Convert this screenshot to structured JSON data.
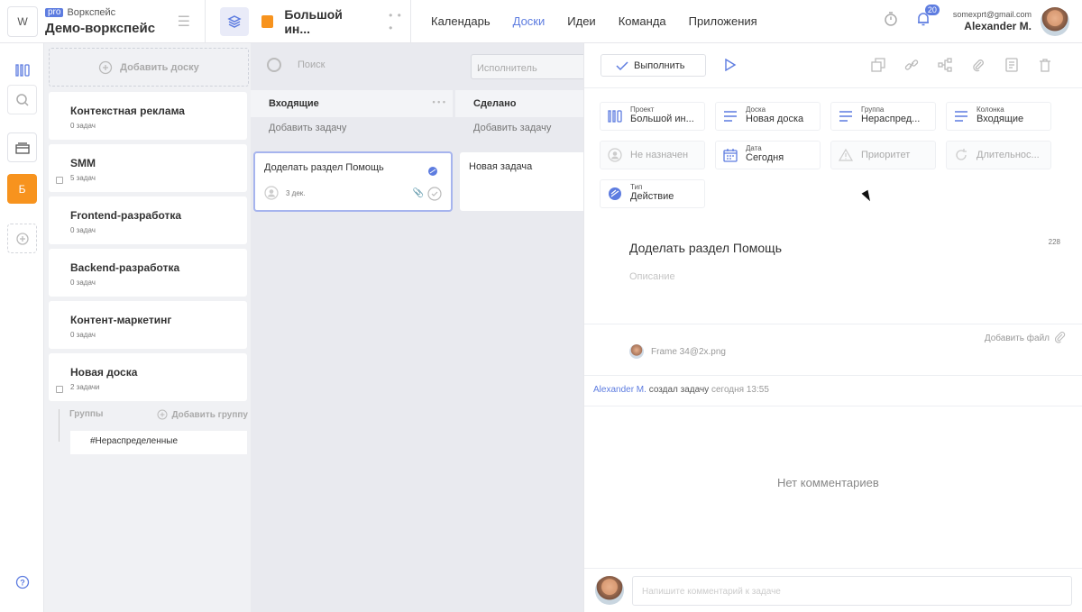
{
  "workspace": {
    "logo_letter": "W",
    "badge": "pro",
    "label": "Воркспейс",
    "name": "Демо-воркспейс"
  },
  "project": {
    "name": "Большой ин...",
    "color": "#f7931e"
  },
  "nav": [
    "Календарь",
    "Доски",
    "Идеи",
    "Команда",
    "Приложения"
  ],
  "nav_active": "Доски",
  "user": {
    "email": "somexprt@gmail.com",
    "name": "Alexander M.",
    "notifications": "20"
  },
  "rail": {
    "letter": "Б"
  },
  "boards": {
    "add_label": "Добавить доску",
    "items": [
      {
        "name": "Контекстная реклама",
        "count": "0 задач"
      },
      {
        "name": "SMM",
        "count": "5 задач"
      },
      {
        "name": "Frontend-разработка",
        "count": "0 задач"
      },
      {
        "name": "Backend-разработка",
        "count": "0 задач"
      },
      {
        "name": "Контент-маркетинг",
        "count": "0 задач"
      },
      {
        "name": "Новая доска",
        "count": "2 задачи"
      }
    ],
    "groups_label": "Группы",
    "add_group_label": "Добавить группу",
    "group_item": "#Нераспределенные"
  },
  "board_area": {
    "search_placeholder": "Поиск",
    "assignee_placeholder": "Исполнитель",
    "columns": [
      {
        "title": "Входящие",
        "add_label": "Добавить задачу"
      },
      {
        "title": "Сделано",
        "add_label": "Добавить задачу"
      }
    ],
    "task": {
      "title": "Доделать раздел Помощь",
      "date": "3 дек."
    },
    "task2": {
      "title": "Новая задача"
    }
  },
  "detail": {
    "do_label": "Выполнить",
    "fields": {
      "project": {
        "label": "Проект",
        "value": "Большой ин..."
      },
      "board": {
        "label": "Доска",
        "value": "Новая доска"
      },
      "group": {
        "label": "Группа",
        "value": "Нераспред..."
      },
      "column": {
        "label": "Колонка",
        "value": "Входящие"
      },
      "assignee": {
        "value": "Не назначен"
      },
      "date": {
        "label": "Дата",
        "value": "Сегодня"
      },
      "priority": {
        "value": "Приоритет"
      },
      "duration": {
        "value": "Длительнос..."
      },
      "type": {
        "label": "Тип",
        "value": "Действие"
      }
    },
    "title": "Доделать раздел Помощь",
    "char_count": "228",
    "description_placeholder": "Описание",
    "add_file_label": "Добавить файл",
    "file_name": "Frame 34@2x.png",
    "log": {
      "user": "Alexander M.",
      "action": "создал задачу",
      "time": "сегодня 13:55"
    },
    "no_comments": "Нет комментариев",
    "comment_placeholder": "Напишите комментарий к задаче"
  },
  "colors": {
    "accent": "#5d7ce0",
    "project": "#f7931e"
  }
}
